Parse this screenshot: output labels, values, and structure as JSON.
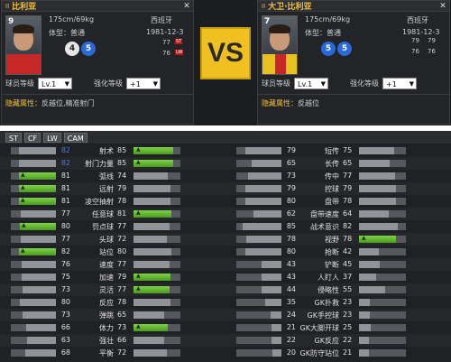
{
  "vs_text": "VS",
  "left_player": {
    "name": "比利亚",
    "jersey": "9",
    "height_weight": "175cm/69kg",
    "nation": "西班牙",
    "body_label": "体型：普通",
    "birthday": "1981-12-3",
    "foot_left": "4",
    "foot_right": "5",
    "rating_1": "77",
    "rating_2": "76",
    "pos_tag_1": "ST",
    "pos_tag_2": "LW",
    "level_label": "球员等级",
    "level_value": "Lv.1",
    "enhance_label": "强化等级",
    "enhance_value": "+1",
    "hidden_label": "隐藏属性：",
    "hidden_value": "反越位,精准射门"
  },
  "right_player": {
    "name": "大卫·比利亚",
    "jersey": "7",
    "height_weight": "175cm/69kg",
    "nation": "西班牙",
    "body_label": "体型：普通",
    "birthday": "1981-12-3",
    "foot_left": "5",
    "foot_right": "5",
    "rating_1": "79",
    "rating_2": "79",
    "rating_3": "76",
    "rating_4": "76",
    "level_label": "球员等级",
    "level_value": "Lv.1",
    "enhance_label": "强化等级",
    "enhance_value": "+1",
    "hidden_label": "隐藏属性：",
    "hidden_value": "反越位"
  },
  "tabs": [
    "ST",
    "CF",
    "LW",
    "CAM"
  ],
  "colors": {
    "accent": "#f0c040",
    "up": "#6cc43a",
    "down_blue": "#4a78d8"
  },
  "stats_left": [
    {
      "a": "82",
      "label": "射术",
      "b": "85",
      "a_blue": true,
      "b_fill": 0.85,
      "a_fill": 0.82,
      "b_green": true
    },
    {
      "a": "82",
      "label": "射门力量",
      "b": "85",
      "a_blue": true,
      "b_fill": 0.85,
      "a_fill": 0.82,
      "b_green": true
    },
    {
      "a": "81",
      "label": "弧线",
      "b": "74",
      "a_blue": false,
      "b_fill": 0.74,
      "a_fill": 0.81,
      "a_green": true
    },
    {
      "a": "81",
      "label": "远射",
      "b": "79",
      "a_blue": false,
      "b_fill": 0.79,
      "a_fill": 0.81,
      "a_green": true
    },
    {
      "a": "81",
      "label": "凌空抽射",
      "b": "78",
      "a_blue": false,
      "b_fill": 0.78,
      "a_fill": 0.81,
      "a_green": true
    },
    {
      "a": "77",
      "label": "任意球",
      "b": "81",
      "a_blue": false,
      "b_fill": 0.81,
      "a_fill": 0.77,
      "b_green": true
    },
    {
      "a": "80",
      "label": "罚点球",
      "b": "77",
      "a_blue": false,
      "b_fill": 0.77,
      "a_fill": 0.8,
      "a_green": true
    },
    {
      "a": "77",
      "label": "头球",
      "b": "72",
      "a_blue": false,
      "b_fill": 0.72,
      "a_fill": 0.77
    },
    {
      "a": "82",
      "label": "站位",
      "b": "80",
      "a_blue": false,
      "b_fill": 0.8,
      "a_fill": 0.82,
      "a_green": true
    },
    {
      "a": "76",
      "label": "速度",
      "b": "77",
      "a_blue": false,
      "b_fill": 0.77,
      "a_fill": 0.76
    },
    {
      "a": "75",
      "label": "加速",
      "b": "79",
      "a_blue": false,
      "b_fill": 0.79,
      "a_fill": 0.75,
      "b_green": true
    },
    {
      "a": "73",
      "label": "灵活",
      "b": "77",
      "a_blue": false,
      "b_fill": 0.77,
      "a_fill": 0.73,
      "b_green": true
    },
    {
      "a": "80",
      "label": "反应",
      "b": "78",
      "a_blue": false,
      "b_fill": 0.78,
      "a_fill": 0.8
    },
    {
      "a": "73",
      "label": "弹跳",
      "b": "65",
      "a_blue": false,
      "b_fill": 0.65,
      "a_fill": 0.73
    },
    {
      "a": "66",
      "label": "体力",
      "b": "73",
      "a_blue": false,
      "b_fill": 0.73,
      "a_fill": 0.66,
      "b_green": true
    },
    {
      "a": "63",
      "label": "强壮",
      "b": "66",
      "a_blue": false,
      "b_fill": 0.66,
      "a_fill": 0.63
    },
    {
      "a": "68",
      "label": "平衡",
      "b": "72",
      "a_blue": false,
      "b_fill": 0.72,
      "a_fill": 0.68
    }
  ],
  "stats_right": [
    {
      "a": "79",
      "label": "短传",
      "b": "75",
      "a_fill": 0.79,
      "b_fill": 0.75
    },
    {
      "a": "65",
      "label": "长传",
      "b": "65",
      "a_fill": 0.65,
      "b_fill": 0.65
    },
    {
      "a": "73",
      "label": "传中",
      "b": "77",
      "a_fill": 0.73,
      "b_fill": 0.77
    },
    {
      "a": "79",
      "label": "控球",
      "b": "79",
      "a_fill": 0.79,
      "b_fill": 0.79
    },
    {
      "a": "80",
      "label": "盘带",
      "b": "78",
      "a_fill": 0.8,
      "b_fill": 0.78
    },
    {
      "a": "62",
      "label": "盘带速度",
      "b": "64",
      "a_fill": 0.62,
      "b_fill": 0.64
    },
    {
      "a": "85",
      "label": "战术意识",
      "b": "82",
      "a_fill": 0.85,
      "b_fill": 0.82
    },
    {
      "a": "78",
      "label": "视野",
      "b": "78",
      "a_fill": 0.78,
      "b_fill": 0.78,
      "b_green": true
    },
    {
      "a": "80",
      "label": "抢断",
      "b": "42",
      "a_fill": 0.8,
      "b_fill": 0.42
    },
    {
      "a": "43",
      "label": "铲断",
      "b": "45",
      "a_fill": 0.43,
      "b_fill": 0.45
    },
    {
      "a": "43",
      "label": "人盯人",
      "b": "37",
      "a_fill": 0.43,
      "b_fill": 0.37
    },
    {
      "a": "44",
      "label": "侵略性",
      "b": "55",
      "a_fill": 0.44,
      "b_fill": 0.55
    },
    {
      "a": "35",
      "label": "GK扑救",
      "b": "23",
      "a_fill": 0.35,
      "b_fill": 0.23
    },
    {
      "a": "24",
      "label": "GK手控球",
      "b": "23",
      "a_fill": 0.24,
      "b_fill": 0.23
    },
    {
      "a": "21",
      "label": "GK大脚开球",
      "b": "25",
      "a_fill": 0.21,
      "b_fill": 0.25
    },
    {
      "a": "22",
      "label": "GK反应",
      "b": "22",
      "a_fill": 0.22,
      "b_fill": 0.22
    },
    {
      "a": "20",
      "label": "GK防守站位",
      "b": "21",
      "a_fill": 0.2,
      "b_fill": 0.21
    }
  ]
}
